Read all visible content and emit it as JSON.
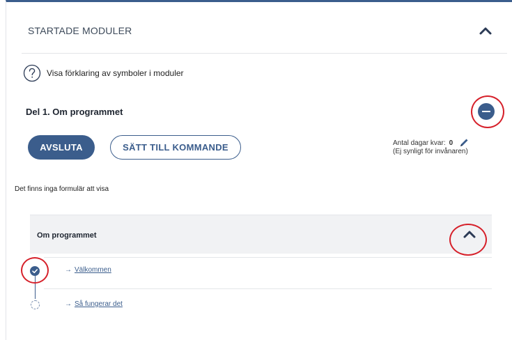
{
  "header": {
    "title": "STARTADE MODULER"
  },
  "legend": {
    "text": "Visa förklaring av symboler i moduler"
  },
  "section": {
    "title": "Del 1. Om programmet",
    "buttons": {
      "finish": "AVSLUTA",
      "set_upcoming": "SÄTT TILL KOMMANDE"
    },
    "days": {
      "label": "Antal dagar kvar:",
      "value": "0",
      "note": "(Ej synligt för invånaren)"
    },
    "no_forms": "Det finns inga formulär att visa"
  },
  "module": {
    "title": "Om programmet",
    "steps": [
      {
        "arrow": "→",
        "label": "Välkommen",
        "status": "done"
      },
      {
        "arrow": "→",
        "label": "Så fungerar det",
        "status": "pending"
      }
    ]
  },
  "colors": {
    "accent": "#3b5d8c",
    "highlight": "#d6202a"
  }
}
